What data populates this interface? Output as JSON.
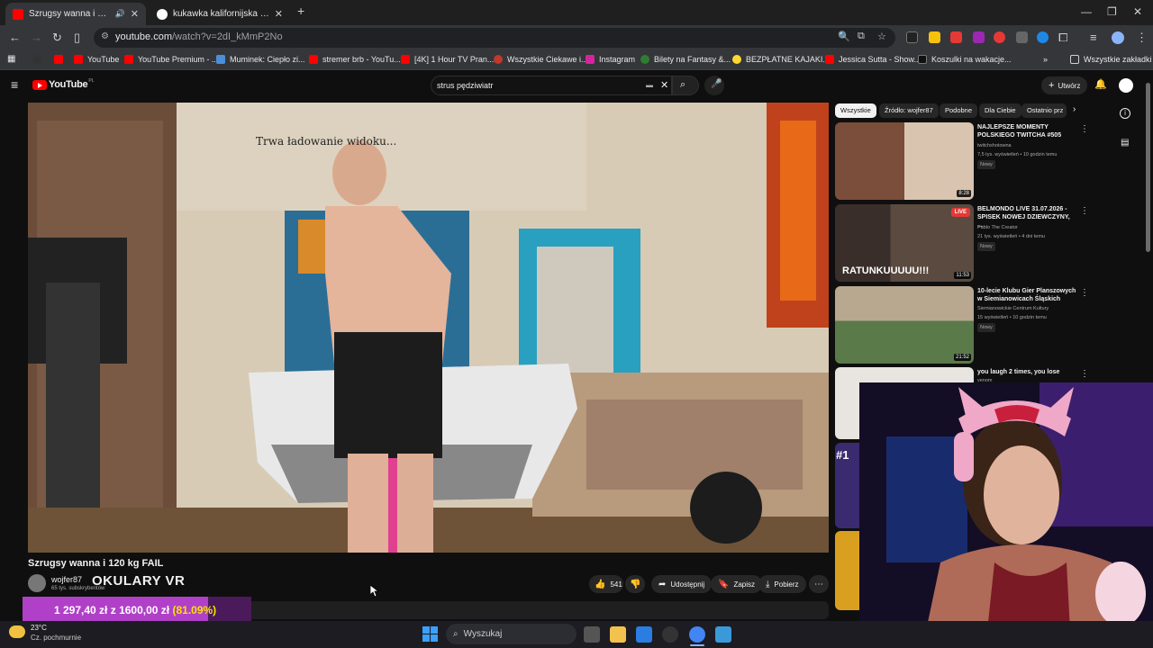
{
  "browser": {
    "tabs": [
      {
        "title": "Szrugsy wanna i 120 kg FAIL",
        "active": true
      },
      {
        "title": "kukawka kalifornijska - Szukaj w Google",
        "active": false
      }
    ],
    "url_host": "youtube.com",
    "url_path": "/watch?v=2dI_kMmP2No",
    "bookmarks": [
      "YouTube",
      "YouTube Premium - ...",
      "Muminek: Ciepło zi...",
      "stremer brb - YouTu...",
      "[4K] 1 Hour TV Pran...",
      "Wszystkie Ciekawe i...",
      "Instagram",
      "Bilety na Fantasy &...",
      "BEZPŁATNE KAJAKI...",
      "Jessica Sutta - Show...",
      "Koszulki na wakacje..."
    ],
    "all_bookmarks": "Wszystkie zakładki"
  },
  "youtube": {
    "logo": "YouTube",
    "logo_region": "PL",
    "search_query": "strus pędziwiatr",
    "create_label": "Utwórz",
    "video_overlay_text": "Trwa ładowanie widoku...",
    "video_title": "Szrugsy wanna i 120 kg FAIL",
    "channel_name": "wojfer87",
    "channel_subs": "65 tys. subskrybentów",
    "overlay_caption": "OKULARY VR",
    "likes": "541",
    "share_label": "Udostępnij",
    "save_label": "Zapisz",
    "download_label": "Pobierz",
    "chips": [
      "Wszystkie",
      "Źródło: wojfer87",
      "Podobne",
      "Dla Ciebie",
      "Ostatnio prz"
    ],
    "recommendations": [
      {
        "title": "NAJLEPSZE MOMENTY POLSKIEGO TWITCHA #505",
        "channel": "twitchshotowna",
        "stats": "7,5 tys. wyświetleń • 10 godzin temu",
        "badge": "Nowy",
        "duration": "8:28"
      },
      {
        "title": "BELMONDO LIVE 31.07.2026 - SPISEK NOWEJ DZIEWCZYNY, ...",
        "channel": "Pablo The Creator",
        "stats": "21 tys. wyświetleń • 4 dni temu",
        "badge": "Nowy",
        "duration": "11:53",
        "thumb_text": "RATUNKUUUUU!!!",
        "live_label": "LIVE"
      },
      {
        "title": "10-lecie Klubu Gier Planszowych w Siemianowicach Śląskich",
        "channel": "Siemianowickie Centrum Kultury",
        "stats": "15 wyświetleń • 10 godzin temu",
        "badge": "Nowy",
        "duration": "21:52"
      },
      {
        "title": "you laugh 2 times, you lose",
        "channel": "venom",
        "stats": "",
        "badge": "",
        "duration": ""
      }
    ],
    "partial_rank": "#1"
  },
  "donation": {
    "current": "1 297,40 zł",
    "separator": "z",
    "goal": "1600,00 zł",
    "percent_text": "(81.09%)",
    "progress": 0.8109
  },
  "taskbar": {
    "weather_temp": "23°C",
    "weather_desc": "Cz. pochmurnie",
    "search_label": "Wyszukaj"
  },
  "colors": {
    "yt_red": "#ff0000",
    "donation_fill": "#b040c8",
    "donation_pct": "#f8e400"
  }
}
